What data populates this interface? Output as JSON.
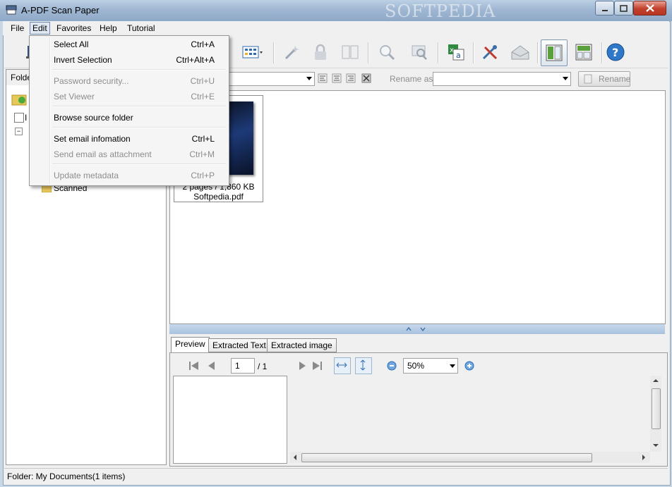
{
  "window": {
    "title": "A-PDF Scan Paper",
    "watermark": "SOFTPEDIA",
    "min": "—",
    "max": "□",
    "close": "✕"
  },
  "menubar": {
    "file": "File",
    "edit": "Edit",
    "favorites": "Favorites",
    "help": "Help",
    "tutorial": "Tutorial"
  },
  "editmenu": {
    "select_all": {
      "label": "Select All",
      "shortcut": "Ctrl+A"
    },
    "invert_selection": {
      "label": "Invert Selection",
      "shortcut": "Ctrl+Alt+A"
    },
    "password_security": {
      "label": "Password security...",
      "shortcut": "Ctrl+U"
    },
    "set_viewer": {
      "label": "Set Viewer",
      "shortcut": "Ctrl+E"
    },
    "browse_source_folder": {
      "label": "Browse source folder"
    },
    "set_email": {
      "label": "Set email infomation",
      "shortcut": "Ctrl+L"
    },
    "send_email": {
      "label": "Send email as attachment",
      "shortcut": "Ctrl+M"
    },
    "update_metadata": {
      "label": "Update metadata",
      "shortcut": "Ctrl+P"
    }
  },
  "leftpanel": {
    "header": "Folde",
    "include_label": "I",
    "tree_item": "Scanned"
  },
  "filterbar": {
    "rename_as_label": "Rename as:",
    "rename_value": "",
    "rename_button": "Rename"
  },
  "thumb": {
    "info": "2 pages / 1,860 KB",
    "filename": "Softpedia.pdf"
  },
  "tabs": {
    "preview": "Preview",
    "extracted_text": "Extracted Text",
    "extracted_image": "Extracted image"
  },
  "nav": {
    "page_current": "1",
    "page_total": "/ 1",
    "zoom": "50%"
  },
  "statusbar": {
    "text": "Folder: My Documents(1 items)"
  },
  "colors": {
    "title_bar": "#9fb7d2",
    "selected_menu": "#dfe8f2",
    "accent_blue": "#2f78c9"
  }
}
